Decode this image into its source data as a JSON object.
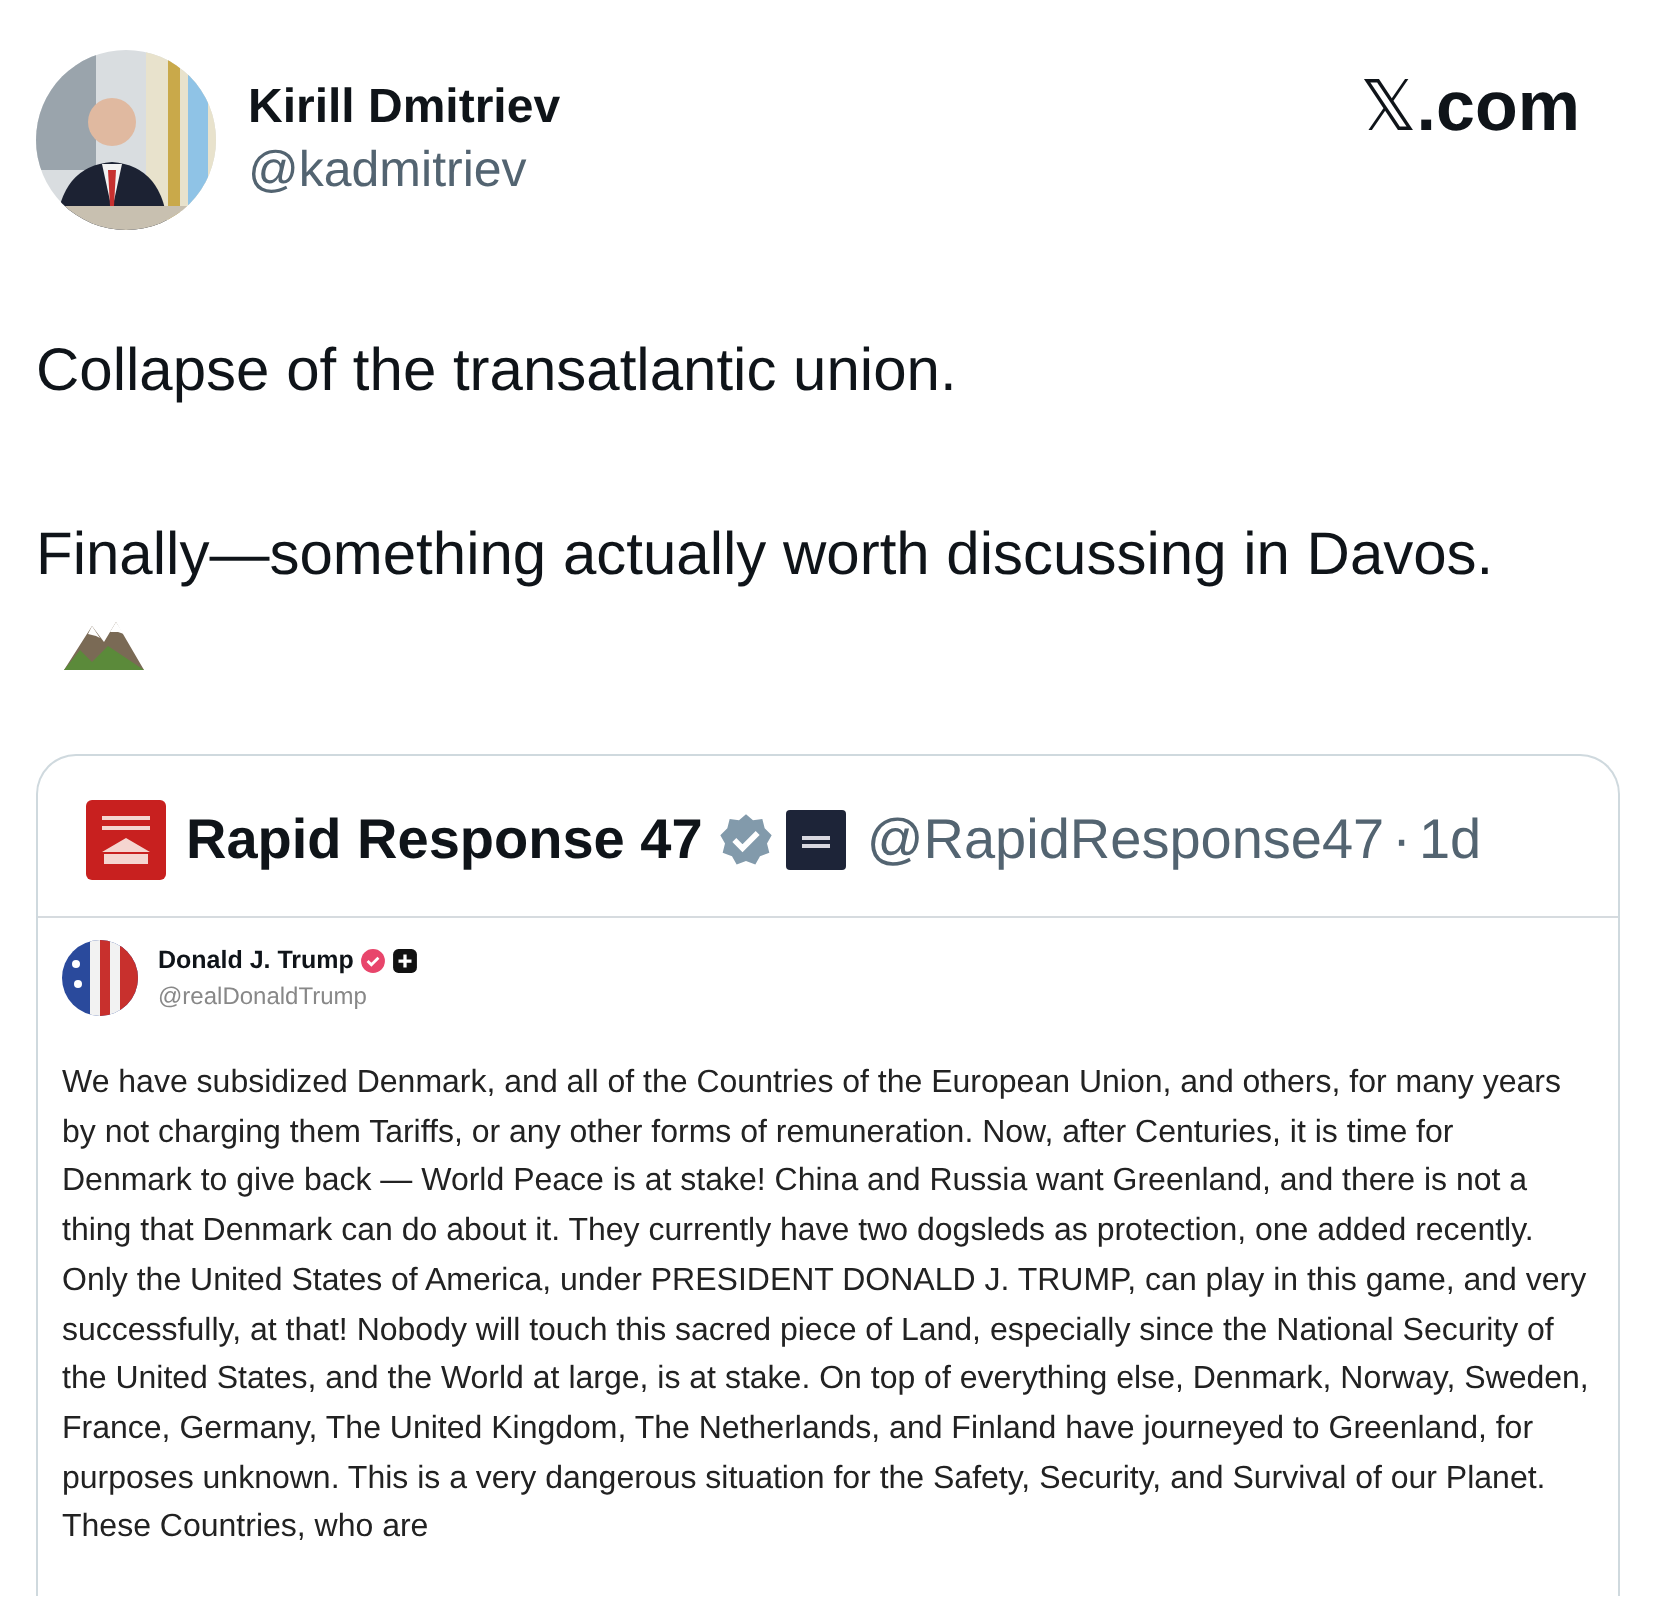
{
  "author": {
    "name": "Kirill Dmitriev",
    "handle": "@kadmitriev"
  },
  "site": {
    "prefix": "𝕏",
    "suffix": ".com"
  },
  "tweet": {
    "paragraphs": [
      "Collapse of the transatlantic union.",
      "Finally—something actually worth discussing in Davos."
    ]
  },
  "quote": {
    "account": "Rapid Response 47",
    "handle": "@RapidResponse47",
    "separator": "·",
    "age": "1d",
    "post": {
      "author": "Donald J. Trump",
      "handle": "@realDonaldTrump",
      "text": "We have subsidized Denmark, and all of the Countries of the European Union, and others, for many years by not charging them Tariffs, or any other forms of remuneration. Now, after Centuries, it is time for Denmark to give back — World Peace is at stake! China and Russia want Greenland, and there is not a thing that Denmark can do about it. They currently have two dogsleds as protection, one added recently. Only the United States of America, under PRESIDENT DONALD J. TRUMP, can play in this game, and very successfully, at that! Nobody will touch this sacred piece of Land, especially since the National Security of the United States, and the World at large, is at stake. On top of everything else, Denmark, Norway, Sweden, France, Germany, The United Kingdom, The Netherlands, and Finland have journeyed to Greenland, for purposes unknown. This is a very dangerous situation for the Safety, Security, and Survival of our Planet. These Countries, who are"
    }
  }
}
